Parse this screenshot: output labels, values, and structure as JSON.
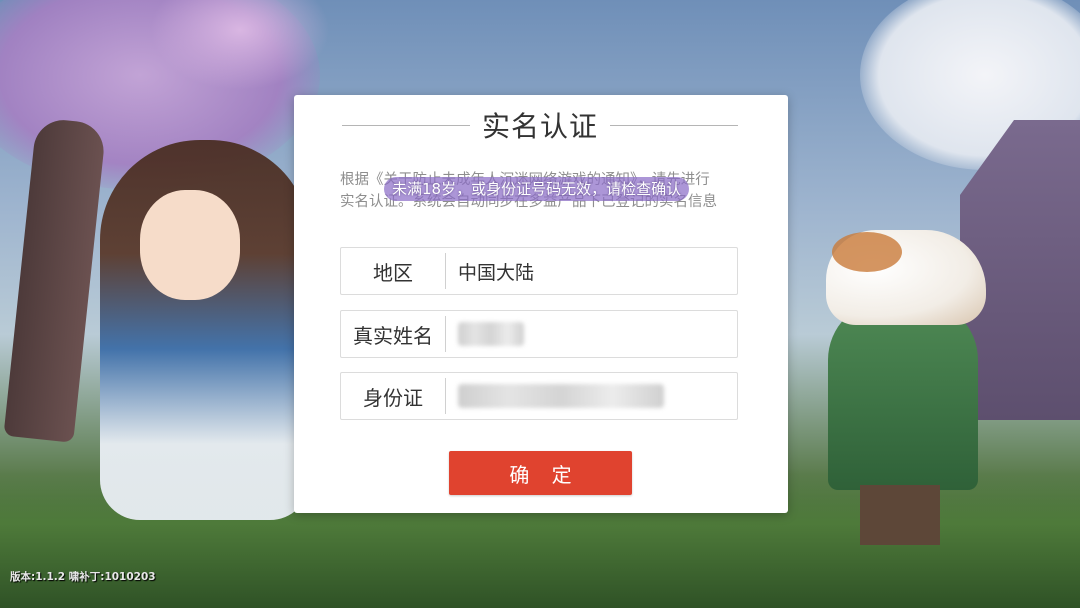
{
  "dialog": {
    "title": "实名认证",
    "notice_line1": "根据《关于防止未成年人沉迷网络游戏的通知》，请先进行",
    "notice_line2": "实名认证。系统会自动同步在多益产品下已登记的实名信息",
    "toast": "未满18岁，或身份证号码无效，请检查确认",
    "fields": [
      {
        "label": "地区",
        "value": "中国大陆"
      },
      {
        "label": "真实姓名",
        "value": ""
      },
      {
        "label": "身份证",
        "value": ""
      }
    ],
    "confirm_label": "确 定"
  },
  "footer": {
    "version": "版本:1.1.2 啸补丁:1010203"
  },
  "colors": {
    "confirm_button": "#e0432f",
    "dialog_bg": "#ffffff",
    "toast_bg": "#8c6ec8"
  }
}
